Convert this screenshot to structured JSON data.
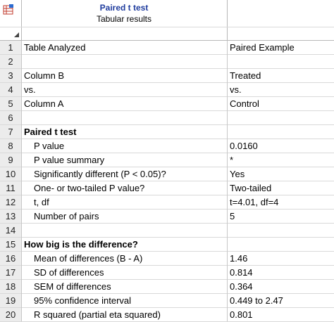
{
  "header": {
    "title": "Paired t test",
    "subtitle": "Tabular results"
  },
  "rows": [
    {
      "num": "1",
      "label": "Table Analyzed",
      "value": "Paired Example"
    },
    {
      "num": "2",
      "label": "",
      "value": ""
    },
    {
      "num": "3",
      "label": "Column B",
      "value": "Treated"
    },
    {
      "num": "4",
      "label": "vs.",
      "value": "vs."
    },
    {
      "num": "5",
      "label": "Column A",
      "value": "Control"
    },
    {
      "num": "6",
      "label": "",
      "value": ""
    },
    {
      "num": "7",
      "label": "Paired t test",
      "value": ""
    },
    {
      "num": "8",
      "label": "P value",
      "value": "0.0160"
    },
    {
      "num": "9",
      "label": "P value summary",
      "value": "*"
    },
    {
      "num": "10",
      "label": "Significantly different (P < 0.05)?",
      "value": "Yes"
    },
    {
      "num": "11",
      "label": "One- or two-tailed P value?",
      "value": "Two-tailed"
    },
    {
      "num": "12",
      "label": "t, df",
      "value": "t=4.01, df=4"
    },
    {
      "num": "13",
      "label": "Number of pairs",
      "value": "5"
    },
    {
      "num": "14",
      "label": "",
      "value": ""
    },
    {
      "num": "15",
      "label": "How big is the difference?",
      "value": ""
    },
    {
      "num": "16",
      "label": "Mean of differences (B - A)",
      "value": "1.46"
    },
    {
      "num": "17",
      "label": "SD of differences",
      "value": "0.814"
    },
    {
      "num": "18",
      "label": "SEM of differences",
      "value": "0.364"
    },
    {
      "num": "19",
      "label": "95% confidence interval",
      "value": "0.449 to 2.47"
    },
    {
      "num": "20",
      "label": "R squared (partial eta squared)",
      "value": "0.801"
    }
  ],
  "colors": {
    "title": "#1f3c9e",
    "row_header_bg": "#ececec",
    "grid": "#d9d9d9"
  }
}
